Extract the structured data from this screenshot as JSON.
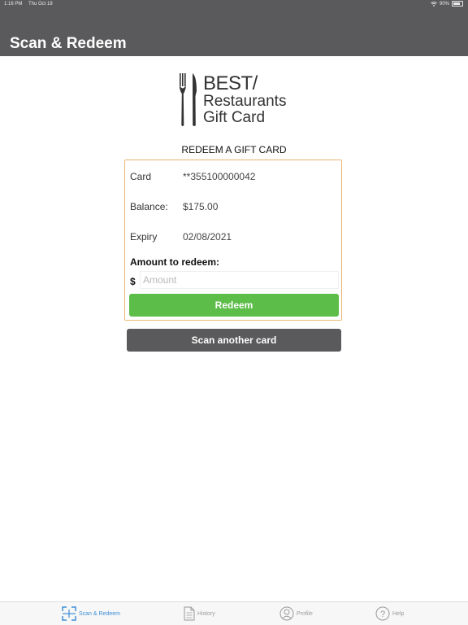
{
  "status_bar": {
    "time": "1:16 PM",
    "date": "Thu Oct 18",
    "battery": "90%"
  },
  "header": {
    "title": "Scan & Redeem"
  },
  "logo": {
    "line1": "BEST/",
    "line2": "Restaurants",
    "line3": "Gift Card",
    "icon": "fork-knife-icon"
  },
  "main": {
    "section_title": "REDEEM A GIFT CARD",
    "card_label": "Card",
    "card_value": "**355100000042",
    "balance_label": "Balance:",
    "balance_value": "$175.00",
    "expiry_label": "Expiry",
    "expiry_value": "02/08/2021",
    "amount_label": "Amount to redeem:",
    "currency": "$",
    "amount_placeholder": "Amount",
    "amount_value": "",
    "redeem_label": "Redeem",
    "scan_another_label": "Scan another card"
  },
  "tabs": [
    {
      "label": "Scan & Redeem",
      "icon": "scan-icon",
      "active": true
    },
    {
      "label": "History",
      "icon": "document-icon",
      "active": false
    },
    {
      "label": "Profile",
      "icon": "profile-icon",
      "active": false
    },
    {
      "label": "Help",
      "icon": "help-icon",
      "active": false
    }
  ],
  "colors": {
    "header": "#5a5a5c",
    "card_border": "#e8b874",
    "redeem_button": "#5cbd48",
    "scan_button": "#5a5a5c",
    "tab_active": "#3d8fd6",
    "tab_inactive": "#9a9a9a"
  }
}
